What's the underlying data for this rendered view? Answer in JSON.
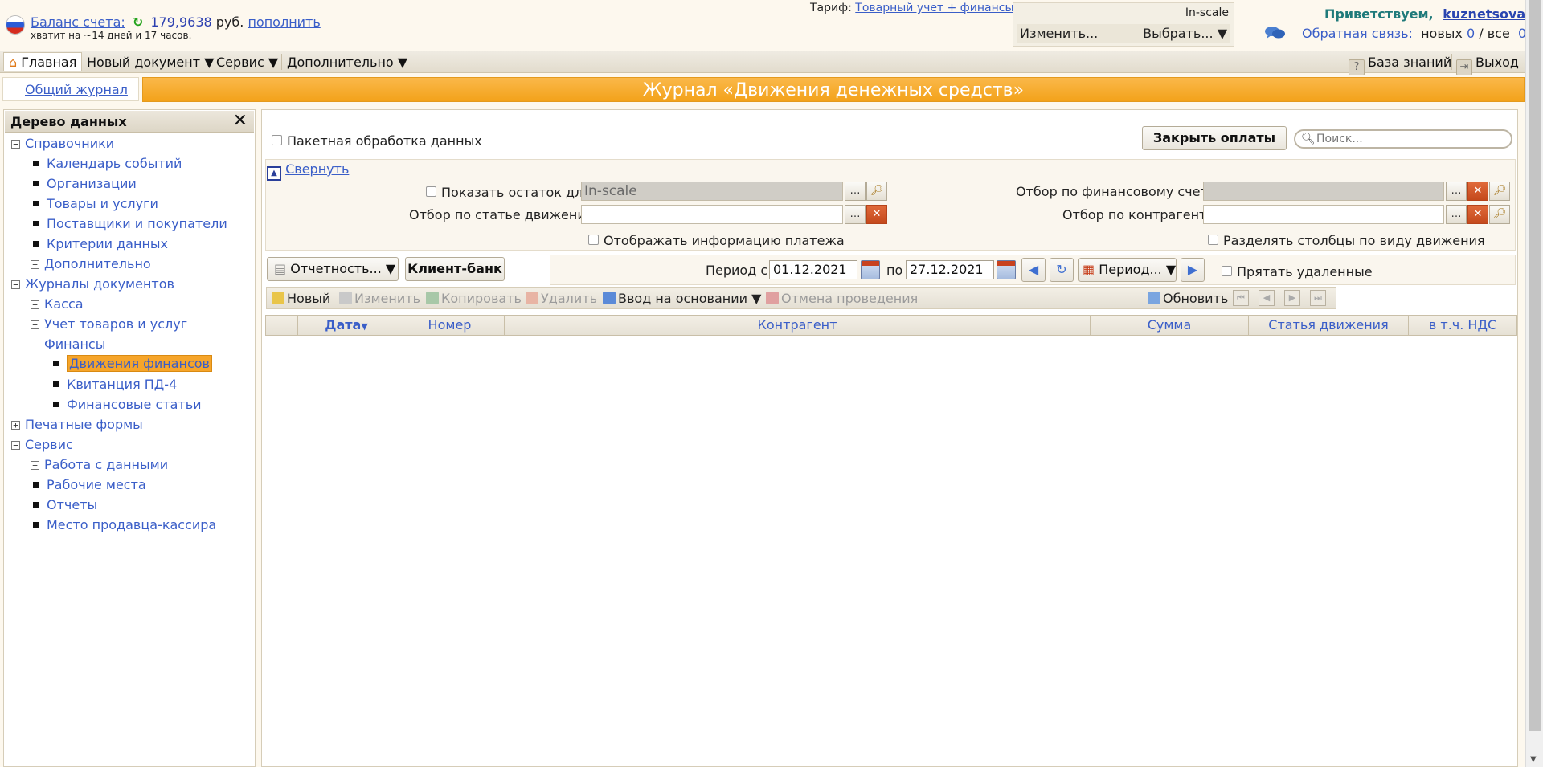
{
  "header": {
    "balance_label": "Баланс счета:",
    "balance_amount": "179,9638",
    "balance_currency": "руб.",
    "topup_link": "пополнить",
    "days_left": "хватит на ~14 дней и 17 часов.",
    "tariff_label": "Тариф:",
    "tariff_value": "Товарный учет + финансы",
    "org_name": "In-scale",
    "org_change": "Изменить...",
    "org_choose": "Выбрать... ▼",
    "greeting": "Приветствуем,",
    "username": "kuznetsova",
    "feedback_link": "Обратная связь:",
    "feedback_new_label": "новых",
    "feedback_new_count": "0",
    "feedback_sep": "/ все",
    "feedback_all_count": "0"
  },
  "menu": {
    "home": "Главная",
    "new_doc": "Новый документ ▼",
    "service": "Сервис ▼",
    "extra": "Дополнительно ▼",
    "knowledge_base": "База знаний",
    "exit": "Выход"
  },
  "subnav": {
    "general_journal": "Общий журнал"
  },
  "title": "Журнал «Движения денежных средств»",
  "sidebar": {
    "title": "Дерево данных",
    "close": "✕",
    "items": [
      {
        "label": "Справочники",
        "toggle": "−"
      },
      {
        "label": "Календарь событий"
      },
      {
        "label": "Организации"
      },
      {
        "label": "Товары и услуги"
      },
      {
        "label": "Поставщики и покупатели"
      },
      {
        "label": "Критерии данных"
      },
      {
        "label": "Дополнительно",
        "toggle": "+"
      },
      {
        "label": "Журналы документов",
        "toggle": "−"
      },
      {
        "label": "Касса",
        "toggle": "+"
      },
      {
        "label": "Учет товаров и услуг",
        "toggle": "+"
      },
      {
        "label": "Финансы",
        "toggle": "−"
      },
      {
        "label": "Движения финансов",
        "selected": true
      },
      {
        "label": "Квитанция ПД-4"
      },
      {
        "label": "Финансовые статьи"
      },
      {
        "label": "Печатные формы",
        "toggle": "+"
      },
      {
        "label": "Сервис",
        "toggle": "−"
      },
      {
        "label": "Работа с данными",
        "toggle": "+"
      },
      {
        "label": "Рабочие места"
      },
      {
        "label": "Отчеты"
      },
      {
        "label": "Место продавца-кассира"
      }
    ]
  },
  "main": {
    "batch_label": "Пакетная обработка данных",
    "close_payments": "Закрыть оплаты",
    "search_placeholder": "Поиск...",
    "collapse": "Свернуть",
    "show_balance_label": "Показать остаток для",
    "show_balance_value": "In-scale",
    "filter_article_label": "Отбор по статье движения",
    "filter_account_label": "Отбор по финансовому счету",
    "filter_contractor_label": "Отбор по контрагенту",
    "show_payment_info": "Отображать информацию платежа",
    "split_columns": "Разделять столбцы по виду движения",
    "reports_btn": "Отчетность... ▼",
    "client_bank_btn": "Клиент-банк",
    "period_from_label": "Период с",
    "date_from": "01.12.2021",
    "period_to_label": "по",
    "date_to": "27.12.2021",
    "period_btn": "Период... ▼",
    "hide_deleted": "Прятать удаленные"
  },
  "toolbar": {
    "new": "Новый",
    "edit": "Изменить",
    "copy": "Копировать",
    "delete": "Удалить",
    "based_on": "Ввод на основании ▼",
    "cancel_posting": "Отмена проведения",
    "refresh": "Обновить"
  },
  "grid": {
    "columns": [
      "",
      "Дата",
      "Номер",
      "Контрагент",
      "Сумма",
      "Статья движения",
      "в т.ч. НДС"
    ],
    "sort_indicator": "▼",
    "rows": []
  },
  "colors": {
    "title_bar": "#f3a21a",
    "link": "#3a5ec8",
    "greeting": "#1f7a7a",
    "selected": "#f6a52a"
  }
}
